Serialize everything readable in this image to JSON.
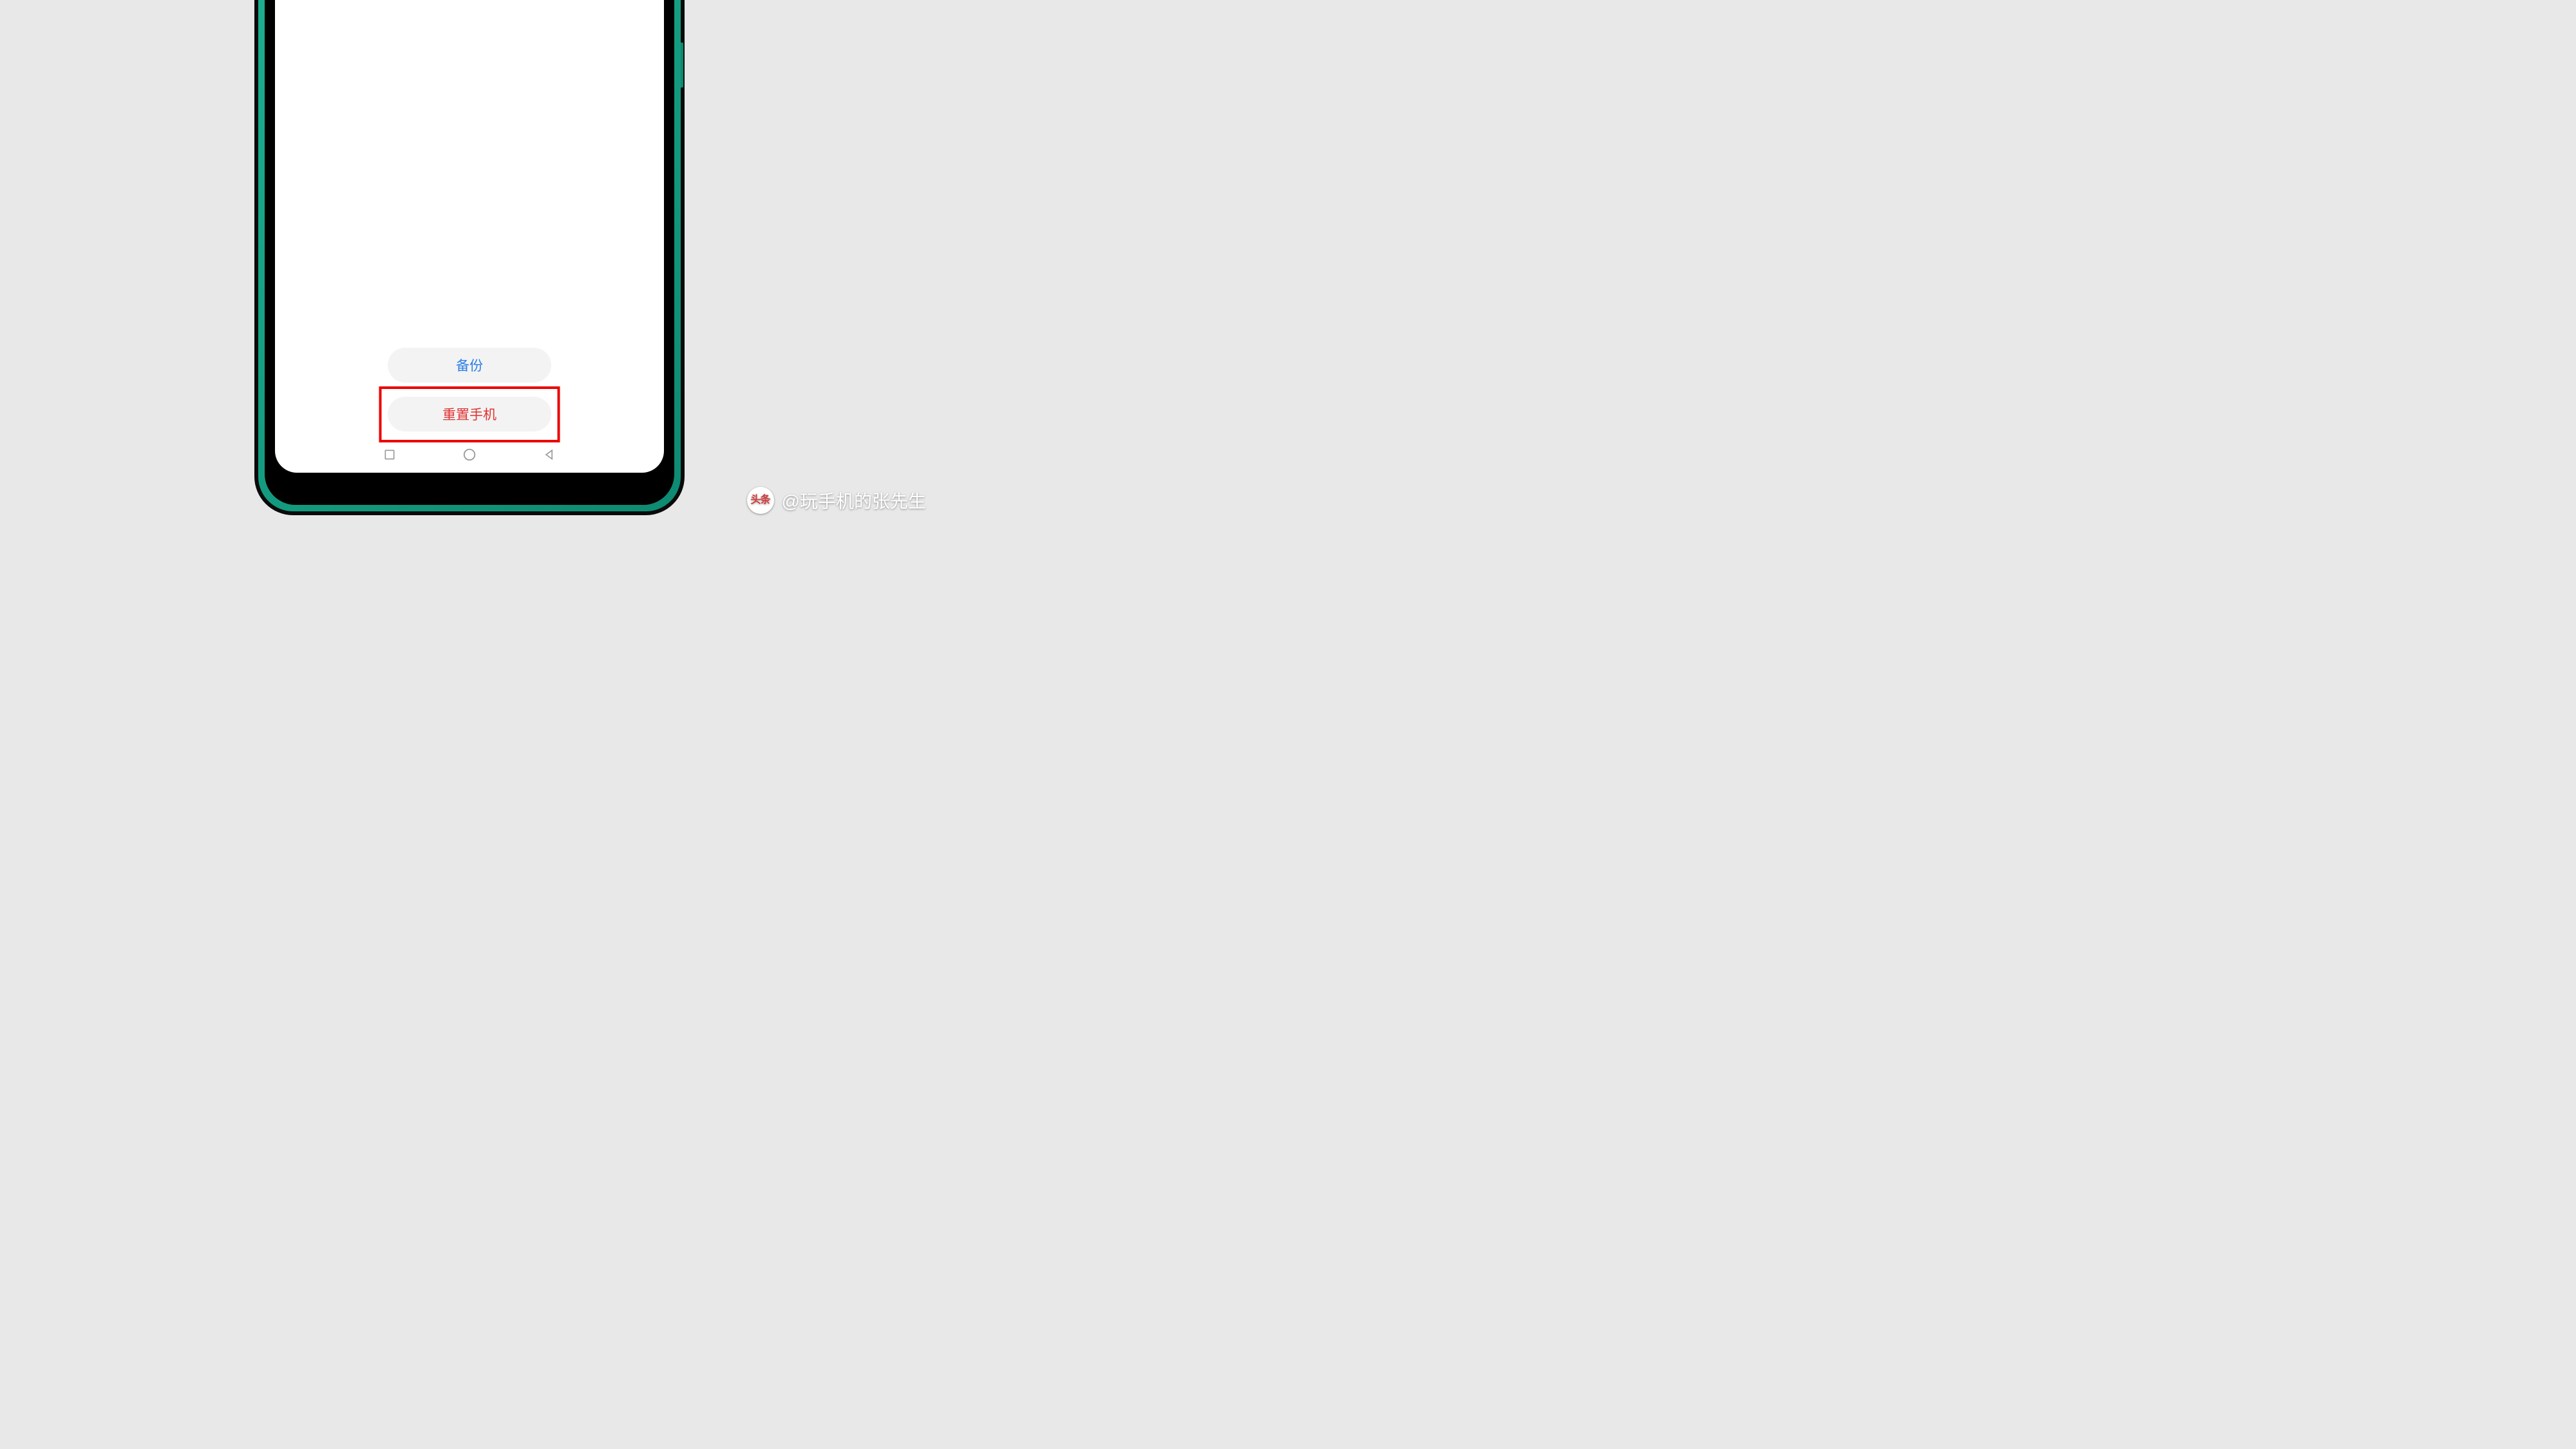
{
  "buttons": {
    "backup": "备份",
    "reset": "重置手机"
  },
  "watermark": {
    "logo_text": "头条",
    "handle": "@玩手机的张先生"
  },
  "nav": {
    "recent": "recent-apps",
    "home": "home",
    "back": "back"
  }
}
